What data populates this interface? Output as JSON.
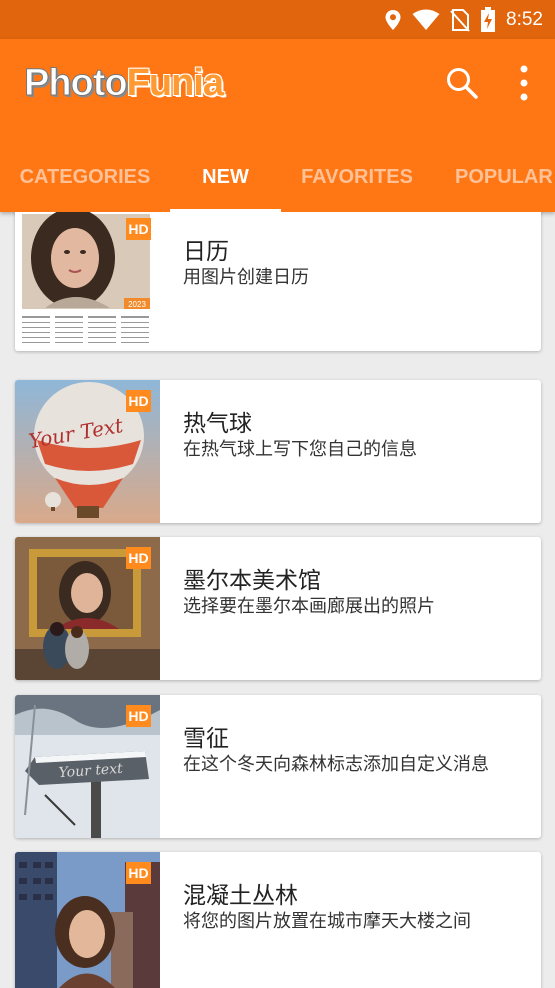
{
  "status_bar": {
    "time": "8:52",
    "icons": [
      "location-icon",
      "wifi-icon",
      "no-sim-icon",
      "battery-charging-icon"
    ]
  },
  "app_bar": {
    "logo_part1": "Photo",
    "logo_part2": "Funia",
    "search_icon": "search-icon",
    "menu_icon": "more-vert-icon"
  },
  "tabs": [
    {
      "label": "CATEGORIES"
    },
    {
      "label": "NEW",
      "active": true
    },
    {
      "label": "FAVORITES"
    },
    {
      "label": "POPULAR"
    }
  ],
  "items": [
    {
      "title": "日历",
      "desc": "用图片创建日历",
      "badge": "HD",
      "thumb_year": "2023"
    },
    {
      "title": "热气球",
      "desc": "在热气球上写下您自己的信息",
      "badge": "HD",
      "thumb_text": "Your Text"
    },
    {
      "title": "墨尔本美术馆",
      "desc": "选择要在墨尔本画廊展出的照片",
      "badge": "HD"
    },
    {
      "title": "雪征",
      "desc": "在这个冬天向森林标志添加自定义消息",
      "badge": "HD",
      "thumb_text": "Your text"
    },
    {
      "title": "混凝土丛林",
      "desc": "将您的图片放置在城市摩天大楼之间",
      "badge": "HD"
    }
  ],
  "colors": {
    "primary": "#ff7615",
    "status_bar": "#e0650c",
    "badge": "#ff8a1d"
  }
}
